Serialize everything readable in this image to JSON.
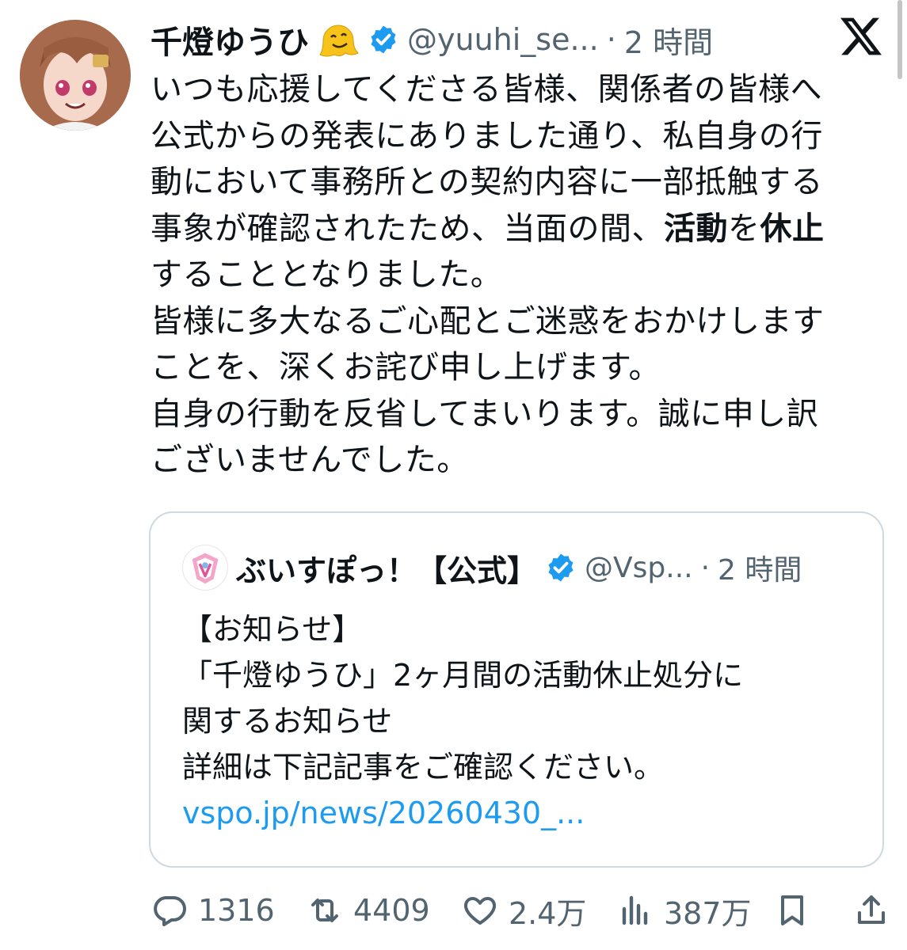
{
  "tweet": {
    "display_name": "千燈ゆうひ",
    "handle": "@yuuhi_se...",
    "dot": "·",
    "time": "2 時間",
    "text_lines": [
      "いつも応援してくださる皆様、関係者の皆様へ",
      "公式からの発表にありました通り、私自身の行",
      "動において事務所との契約内容に一部抵触する",
      "事象が確認されたため、当面の間、",
      "することとなりました。",
      "皆様に多大なるご心配とご迷惑をおかけします",
      "ことを、深くお詫び申し上げます。",
      "自身の行動を反省してまいります。誠に申し訳",
      "ございませんでした。"
    ],
    "bold_1": "活動",
    "mid_1": "を",
    "bold_2": "休止"
  },
  "quote": {
    "display_name": "ぶいすぽっ！【公式】",
    "handle": "@Vsp...",
    "dot": "·",
    "time": "2 時間",
    "text_lines": [
      "【お知らせ】",
      "「千燈ゆうひ」2ヶ月間の活動休止処分に",
      "関するお知らせ",
      "詳細は下記記事をご確認ください。"
    ],
    "link": "vspo.jp/news/20260430_..."
  },
  "actions": {
    "replies": "1316",
    "reposts": "4409",
    "likes": "2.4万",
    "views": "387万"
  },
  "icons": {
    "emoji": "melting-face-icon",
    "verified": "verified-badge-icon",
    "logo": "x-logo-icon"
  },
  "colors": {
    "text": "#0f1419",
    "secondary": "#536471",
    "link": "#1d9bf0",
    "verified": "#1d9bf0",
    "border": "#cfd9de"
  }
}
